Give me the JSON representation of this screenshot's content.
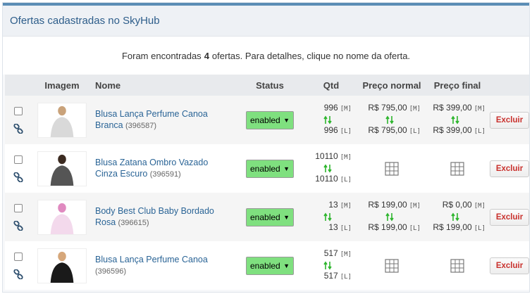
{
  "panel": {
    "title": "Ofertas cadastradas no SkyHub"
  },
  "summary": {
    "prefix": "Foram encontradas",
    "count": "4",
    "suffix": "ofertas. Para detalhes, clique no nome da oferta."
  },
  "table": {
    "headers": {
      "image": "Imagem",
      "name": "Nome",
      "status": "Status",
      "qtd": "Qtd",
      "normal": "Preço normal",
      "final": "Preço final"
    },
    "rows": [
      {
        "name": "Blusa Lança Perfume Canoa Branca",
        "sku": "(396587)",
        "status": "enabled",
        "qtd_m": "996",
        "qtd_l": "996",
        "normal_m": "R$ 795,00",
        "normal_l": "R$ 795,00",
        "final_m": "R$ 399,00",
        "final_l": "R$ 399,00",
        "delete_label": "Excluir",
        "thumb_colors": [
          "#d9d9d9",
          "#c9a27a"
        ]
      },
      {
        "name": "Blusa Zatana Ombro Vazado Cinza Escuro",
        "sku": "(396591)",
        "status": "enabled",
        "qtd_m": "10110",
        "qtd_l": "10110",
        "delete_label": "Excluir",
        "thumb_colors": [
          "#555555",
          "#3b2a20"
        ]
      },
      {
        "name": "Body Best Club Baby Bordado Rosa",
        "sku": "(396615)",
        "status": "enabled",
        "qtd_m": "13",
        "qtd_l": "13",
        "normal_m": "R$ 199,00",
        "normal_l": "R$ 199,00",
        "final_m": "R$ 0,00",
        "final_l": "R$ 199,00",
        "delete_label": "Excluir",
        "thumb_colors": [
          "#f3d9ec",
          "#e08ac0"
        ]
      },
      {
        "name": "Blusa Lança Perfume Canoa",
        "sku": "(396596)",
        "status": "enabled",
        "qtd_m": "517",
        "qtd_l": "517",
        "delete_label": "Excluir",
        "thumb_colors": [
          "#1a1a1a",
          "#d6a77a"
        ]
      }
    ],
    "tags": {
      "m": "[M]",
      "l": "[L]"
    }
  },
  "colors": {
    "accent": "#5b8db5",
    "link": "#2a6496",
    "enabled": "#7fe07f",
    "delete": "#c9302c",
    "sync_arrow": "#2db52d"
  },
  "icons": {
    "checkbox": "checkbox",
    "link": "link-icon",
    "sync": "sync-arrows-icon",
    "grid": "grid-icon",
    "caret": "caret-down-icon"
  }
}
